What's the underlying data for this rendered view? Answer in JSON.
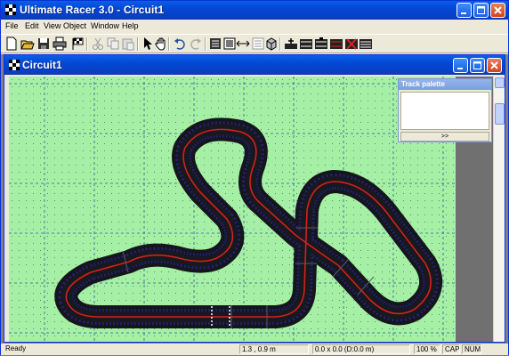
{
  "window": {
    "title": "Ultimate Racer 3.0 - Circuit1"
  },
  "menu": [
    "File",
    "Edit",
    "View",
    "Object",
    "Window",
    "Help"
  ],
  "toolbar": [
    "new-file-icon",
    "open-folder-icon",
    "save-icon",
    "print-icon",
    "flag-icon",
    "cut-icon",
    "copy-icon",
    "paste-icon",
    "pointer-icon",
    "hand-icon",
    "undo-icon",
    "redo-icon",
    "grid-icon",
    "snap-icon",
    "flip-icon",
    "list-icon",
    "cube-icon",
    "add-track-icon",
    "track-a-icon",
    "track-b-icon",
    "track-c-icon",
    "delete-track-icon",
    "track-d-icon"
  ],
  "document": {
    "title": "Circuit1"
  },
  "palette": {
    "title": "Track palette",
    "next_label": ">>"
  },
  "status": {
    "message": "Ready",
    "position": "1.3 , 0.9 m",
    "size": "0.0 x 0.0  (D:0.0 m)",
    "zoom": "100 %",
    "cap": "CAP",
    "num": "NUM"
  },
  "colors": {
    "title_blue": "#0a53d8",
    "canvas_green": "#a6f0a6",
    "track_asphalt": "#1c1c24",
    "lane_red": "#d42020",
    "lane_blue": "#2030c8"
  }
}
